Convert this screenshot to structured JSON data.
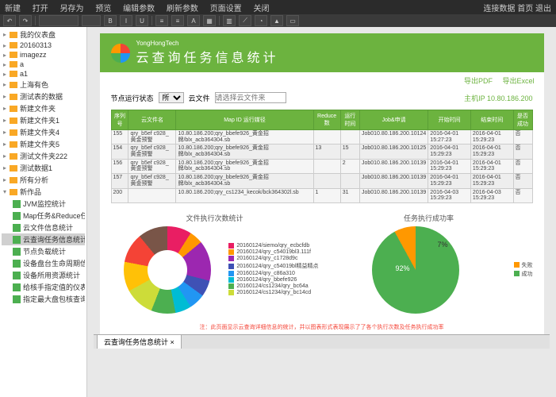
{
  "menu": {
    "left": [
      "新建",
      "打开",
      "另存为",
      "预览",
      "编辑参数",
      "刷新参数",
      "页面设置",
      "关闭"
    ],
    "right": [
      "连接数据 首页 退出"
    ]
  },
  "tree": {
    "folders": [
      "我的仪表盘",
      "20160313",
      "imagezz",
      "a",
      "a1",
      "上海有色",
      "测试表的数据",
      "新建文件夹",
      "新建文件夹1",
      "新建文件夹4",
      "新建文件夹5",
      "测试文件夹222",
      "测试数据1",
      "所有分析"
    ],
    "root": "新作品",
    "files": [
      "JVM监控统计",
      "Map任务&Reduce任务信息统计",
      "云文件信息统计",
      "云查询任务信息统计",
      "节点负载统计",
      "设备盘台生命周期信息",
      "设备所用资源统计",
      "给核手指定值的仪表盘组",
      "指定最大盘包核查询数"
    ]
  },
  "report": {
    "brand": "YongHongTech",
    "title": "云查询任务信息统计",
    "export": {
      "pdf": "导出PDF",
      "excel": "导出Excel"
    },
    "filters": {
      "label1": "节点运行状态",
      "opt1": "所",
      "label2": "云文件",
      "ph2": "请选择云文件来",
      "hostLabel": "主机IP",
      "hostVal": "10.80.186.200"
    },
    "cols": [
      "序列号",
      "云文件名",
      "Map ID 运行媒径",
      "Reduce 数",
      "运行时间",
      "Job&申请",
      "开始时间",
      "结束时间",
      "是否成功"
    ],
    "rows": [
      [
        "155",
        "qry_b5ef c928_黄金预警",
        "10.80.186.200;qry_bbefe926_黄金招牌/blx_acb364304.sb",
        "",
        "",
        "Job010.80.186.200.10124",
        "2016-04-01 15:27:23",
        "2016-04-01 15:29:23",
        "否"
      ],
      [
        "154",
        "qry_b5ef c928_黄金预警",
        "10.80.186.200;qry_bbefe926_黄金招牌/blx_acb364304.sb",
        "13",
        "15",
        "Job010.80.186.200.10125",
        "2016-04-01 15:29:23",
        "2016-04-01 15:29:23",
        "否"
      ],
      [
        "156",
        "qry_b5ef c928_黄金预警",
        "10.80.186.200;qry_bbefe926_黄金招牌/blx_acb364304.sb",
        "",
        "2",
        "Job010.80.186.200.10139",
        "2016-04-01 15:29:23",
        "2016-04-01 15:29:23",
        "否"
      ],
      [
        "157",
        "qry_b5ef c928_黄金预警",
        "10.80.186.200;qry_bbefe926_黄金招牌/blx_acb364304.sb",
        "",
        "",
        "Job010.80.186.200.10139",
        "2016-04-01 15:29:23",
        "2016-04-01 15:29:23",
        "否"
      ],
      [
        "200",
        "",
        "10.80.186.200;qry_cs1234_kecok/bck364302l.sb",
        "1",
        "31",
        "Job010.80.186.200.10139",
        "2016-04-03 15:29:23",
        "2016-04-03 15:29:23",
        "否"
      ]
    ],
    "chart1": {
      "title": "文件执行次数统计"
    },
    "chart2": {
      "title": "任务执行成功率"
    },
    "legend1": [
      "20160124/siemo/qry_ecbcfdb",
      "20160124/qry_c54019bl3.111f",
      "20160124/qry_c1728d9c",
      "20160124/qry_c54019bl精益精点",
      "20160124/qry_c86a310",
      "20160124/qry_bbefe926",
      "20160124/cs1234/qry_bc64a",
      "20160124/cs1234/qry_bc14cd"
    ],
    "legend2": {
      "fail": "失败",
      "success": "成功"
    },
    "pie": {
      "success": "92%",
      "fail": "7%"
    },
    "note": "注：此页面显示云查询详细信息的统计，并以图表形式表现展示了了各个执行次数及任务执行成功率"
  },
  "tab": "云查询任务信息统计 ×",
  "chart_data": [
    {
      "type": "pie",
      "title": "文件执行次数统计",
      "categories": [
        "9%",
        "5%",
        "15%",
        "6%",
        "6%",
        "6%",
        "9%",
        "11%",
        "11%",
        "11%",
        "11%"
      ],
      "values": [
        9,
        5,
        15,
        6,
        6,
        6,
        9,
        11,
        11,
        11,
        11
      ]
    },
    {
      "type": "pie",
      "title": "任务执行成功率",
      "series": [
        {
          "name": "成功",
          "values": [
            92
          ]
        },
        {
          "name": "失败",
          "values": [
            7
          ]
        }
      ]
    }
  ]
}
